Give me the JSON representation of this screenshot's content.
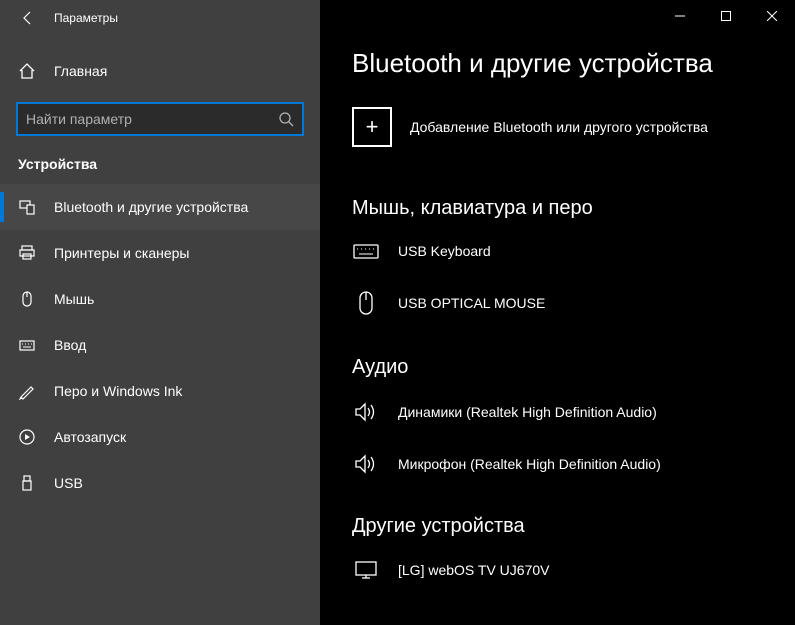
{
  "window": {
    "title": "Параметры"
  },
  "sidebar": {
    "home": "Главная",
    "search_placeholder": "Найти параметр",
    "category": "Устройства",
    "items": [
      {
        "label": "Bluetooth и другие устройства"
      },
      {
        "label": "Принтеры и сканеры"
      },
      {
        "label": "Мышь"
      },
      {
        "label": "Ввод"
      },
      {
        "label": "Перо и Windows Ink"
      },
      {
        "label": "Автозапуск"
      },
      {
        "label": "USB"
      }
    ]
  },
  "page": {
    "title": "Bluetooth и другие устройства",
    "add_label": "Добавление Bluetooth или другого устройства",
    "sections": {
      "input": {
        "heading": "Мышь, клавиатура и перо",
        "devices": [
          {
            "label": "USB Keyboard"
          },
          {
            "label": "USB OPTICAL MOUSE"
          }
        ]
      },
      "audio": {
        "heading": "Аудио",
        "devices": [
          {
            "label": "Динамики (Realtek High Definition Audio)"
          },
          {
            "label": "Микрофон (Realtek High Definition Audio)"
          }
        ]
      },
      "other": {
        "heading": "Другие устройства",
        "devices": [
          {
            "label": "[LG] webOS TV UJ670V"
          }
        ]
      }
    }
  }
}
